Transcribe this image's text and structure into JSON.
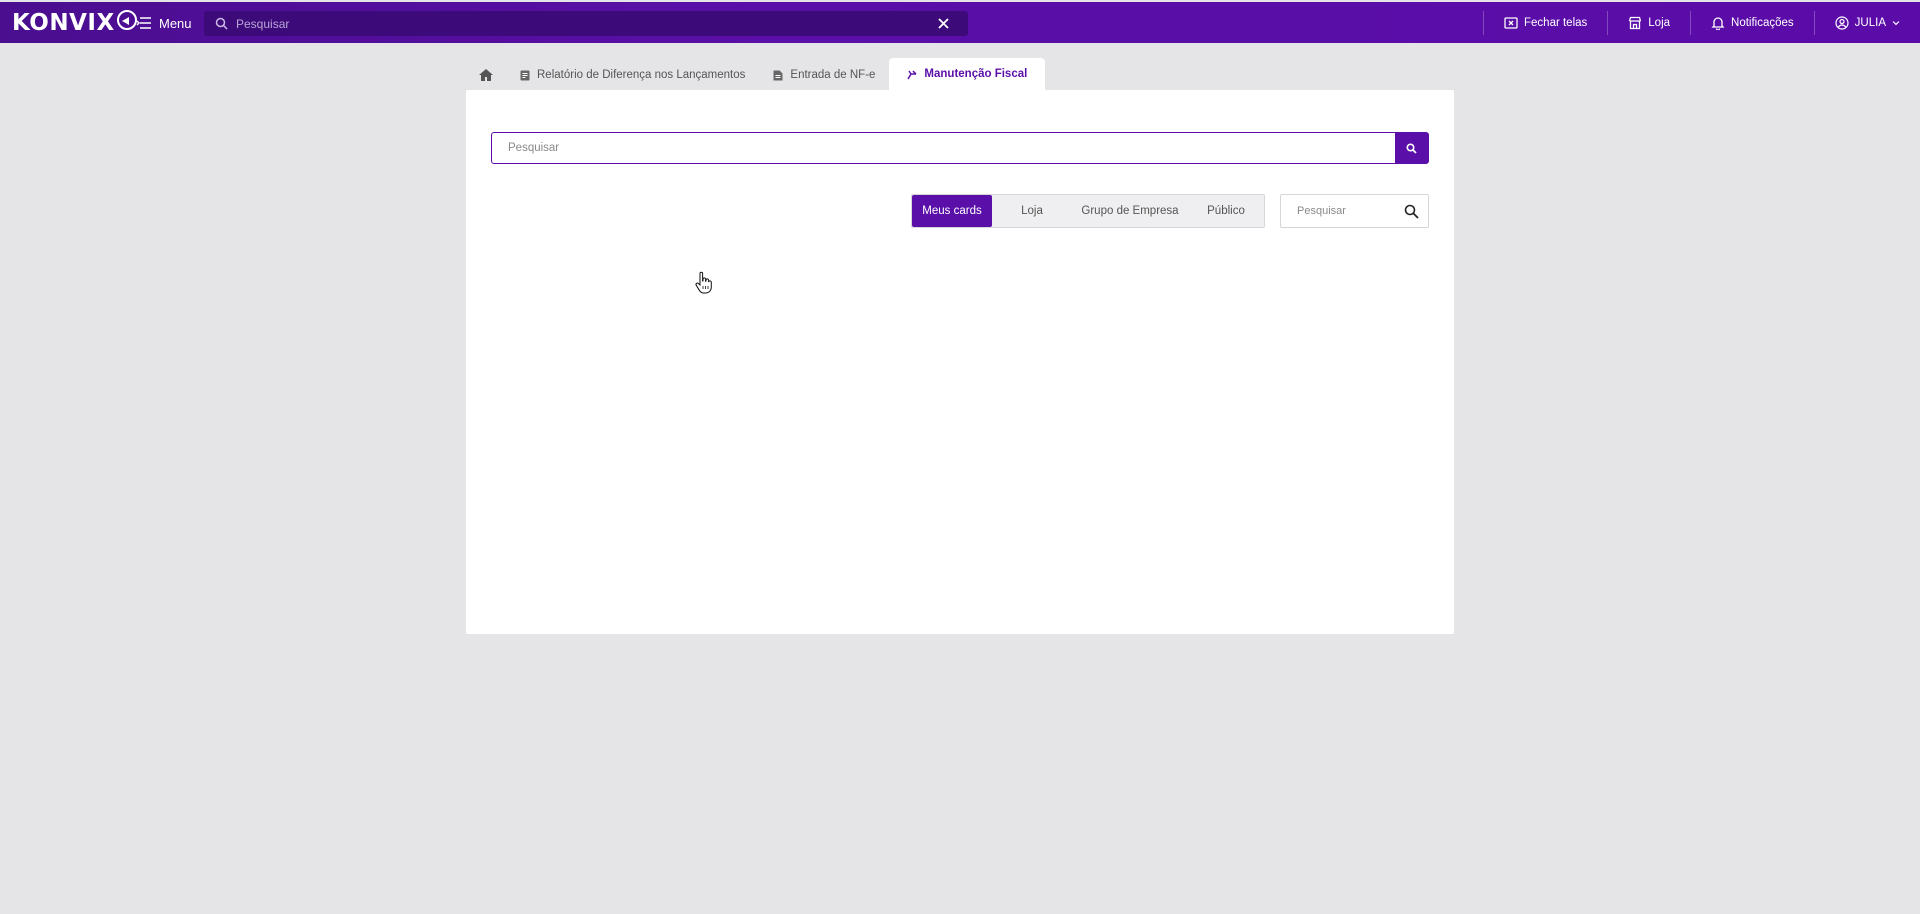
{
  "app": {
    "logo_text": "KONVIX",
    "menu_label": "Menu",
    "top_search": {
      "placeholder": "Pesquisar"
    },
    "top_right": {
      "close_screens": "Fechar telas",
      "store": "Loja",
      "notifications": "Notificações",
      "user": "JULIA"
    }
  },
  "tabs": [
    {
      "label": "",
      "icon": "home-icon"
    },
    {
      "label": "Relatório de Diferença nos Lançamentos",
      "icon": "document-icon"
    },
    {
      "label": "Entrada de NF-e",
      "icon": "file-icon"
    },
    {
      "label": "Manutenção Fiscal",
      "icon": "fiscal-icon",
      "active": true
    }
  ],
  "main": {
    "search": {
      "placeholder": "Pesquisar"
    },
    "filters": {
      "options": [
        "Meus cards",
        "Loja",
        "Grupo de Empresa",
        "Público"
      ],
      "selected": "Meus cards"
    },
    "card_search": {
      "placeholder": "Pesquisar"
    }
  },
  "colors": {
    "brand": "#5a0fa8",
    "topbar": "#4a0e8f",
    "page_bg": "#e5e5e7"
  }
}
